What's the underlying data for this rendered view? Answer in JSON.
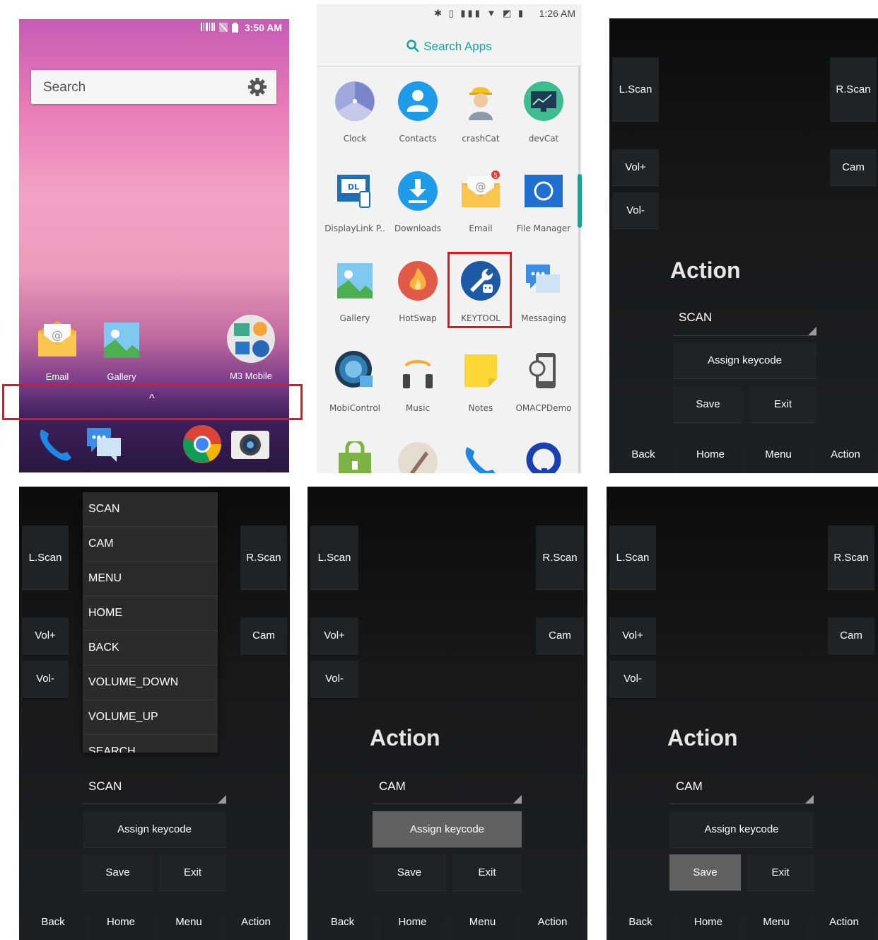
{
  "panel1": {
    "status_time": "3:50 AM",
    "search_placeholder": "Search",
    "apps": [
      {
        "label": "Email",
        "icon": "email-icon"
      },
      {
        "label": "Gallery",
        "icon": "gallery-icon"
      },
      {
        "label": "M3 Mobile",
        "icon": "folder-icon"
      }
    ],
    "dock": [
      "phone-icon",
      "messaging-icon",
      "chrome-icon",
      "camera-icon"
    ],
    "chevron": "^"
  },
  "panel2": {
    "status_time": "1:26 AM",
    "search_label": "Search Apps",
    "apps": [
      {
        "label": "Clock",
        "icon": "clock-icon"
      },
      {
        "label": "Contacts",
        "icon": "contacts-icon"
      },
      {
        "label": "crashCat",
        "icon": "crashcat-icon"
      },
      {
        "label": "devCat",
        "icon": "devcat-icon"
      },
      {
        "label": "DisplayLink P..",
        "icon": "displaylink-icon"
      },
      {
        "label": "Downloads",
        "icon": "downloads-icon"
      },
      {
        "label": "Email",
        "icon": "email-icon",
        "badge": "5"
      },
      {
        "label": "File Manager",
        "icon": "file-manager-icon"
      },
      {
        "label": "Gallery",
        "icon": "gallery-icon"
      },
      {
        "label": "HotSwap",
        "icon": "hotswap-icon"
      },
      {
        "label": "KEYTOOL",
        "icon": "keytool-icon"
      },
      {
        "label": "Messaging",
        "icon": "messaging-icon"
      },
      {
        "label": "MobiControl",
        "icon": "mobicontrol-icon"
      },
      {
        "label": "Music",
        "icon": "music-icon"
      },
      {
        "label": "Notes",
        "icon": "notes-icon"
      },
      {
        "label": "OMACPDemo",
        "icon": "omacp-icon"
      }
    ]
  },
  "keytool": {
    "l_scan": "L.Scan",
    "r_scan": "R.Scan",
    "vol_up": "Vol+",
    "vol_down": "Vol-",
    "cam": "Cam",
    "title": "Action",
    "assign": "Assign keycode",
    "save": "Save",
    "exit": "Exit",
    "bottom": [
      "Back",
      "Home",
      "Menu",
      "Action"
    ]
  },
  "panel3": {
    "spinner_value": "SCAN"
  },
  "panel4": {
    "spinner_value": "SCAN",
    "dropdown_options": [
      "SCAN",
      "CAM",
      "MENU",
      "HOME",
      "BACK",
      "VOLUME_DOWN",
      "VOLUME_UP",
      "SEARCH"
    ]
  },
  "panel5": {
    "spinner_value": "CAM"
  },
  "panel6": {
    "spinner_value": "CAM"
  },
  "colors": {
    "highlight": "#e8141b",
    "accent": "#14a59a",
    "pressed": "#5f6163"
  }
}
